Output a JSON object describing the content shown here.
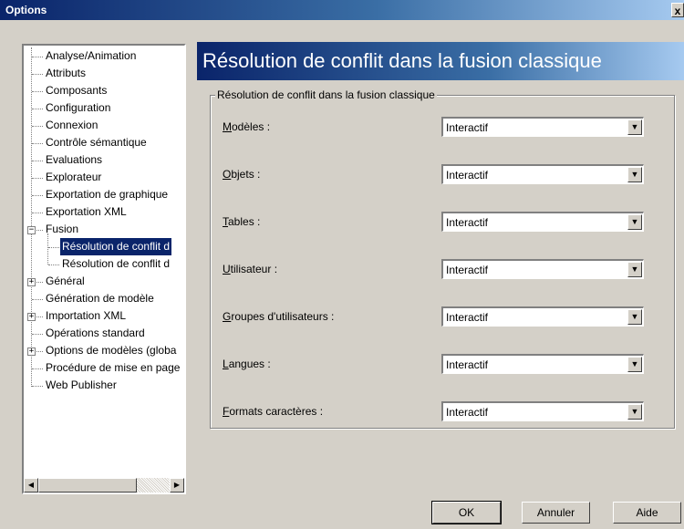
{
  "window": {
    "title": "Options",
    "close_glyph": "x"
  },
  "tree": {
    "items": [
      {
        "label": "Analyse/Animation"
      },
      {
        "label": "Attributs"
      },
      {
        "label": "Composants"
      },
      {
        "label": "Configuration"
      },
      {
        "label": "Connexion"
      },
      {
        "label": "Contrôle sémantique"
      },
      {
        "label": "Evaluations"
      },
      {
        "label": "Explorateur"
      },
      {
        "label": "Exportation de graphique"
      },
      {
        "label": "Exportation XML"
      },
      {
        "label": "Fusion",
        "expander": "−"
      },
      {
        "label": "Résolution de conflit d",
        "selected": true
      },
      {
        "label": "Résolution de conflit d"
      },
      {
        "label": "Général",
        "expander": "+"
      },
      {
        "label": "Génération de modèle"
      },
      {
        "label": "Importation XML",
        "expander": "+"
      },
      {
        "label": "Opérations standard"
      },
      {
        "label": "Options de modèles (globa",
        "expander": "+"
      },
      {
        "label": "Procédure de mise en page"
      },
      {
        "label": "Web Publisher"
      }
    ],
    "scroll_left_glyph": "◀",
    "scroll_right_glyph": "▶"
  },
  "page": {
    "heading": "Résolution de conflit dans la fusion classique",
    "group_title": "Résolution de conflit dans la fusion classique",
    "rows": [
      {
        "mnemonic": "M",
        "rest": "odèles :",
        "value": "Interactif"
      },
      {
        "mnemonic": "O",
        "rest": "bjets :",
        "value": "Interactif"
      },
      {
        "mnemonic": "T",
        "rest": "ables :",
        "value": "Interactif"
      },
      {
        "mnemonic": "U",
        "rest": "tilisateur :",
        "value": "Interactif"
      },
      {
        "mnemonic": "G",
        "rest": "roupes d'utilisateurs :",
        "value": "Interactif"
      },
      {
        "mnemonic": "L",
        "rest": "angues :",
        "value": "Interactif"
      },
      {
        "mnemonic": "F",
        "rest": "ormats caractères :",
        "value": "Interactif"
      }
    ],
    "dropdown_glyph": "▼"
  },
  "buttons": {
    "ok": "OK",
    "cancel": "Annuler",
    "help": "Aide"
  }
}
